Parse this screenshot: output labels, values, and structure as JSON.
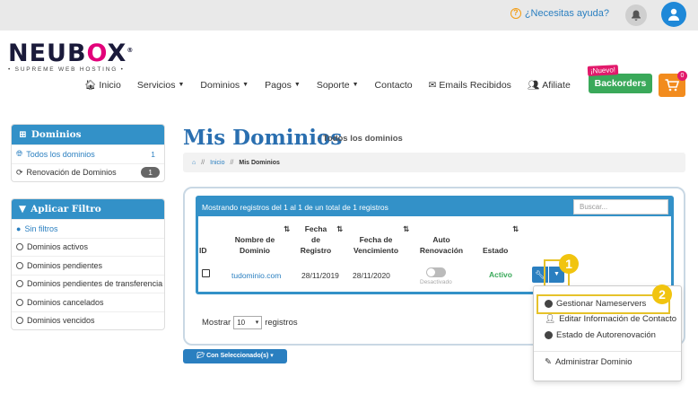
{
  "topbar": {
    "help_text": "¿Necesitas ayuda?"
  },
  "logo": {
    "name_a": "NEUB",
    "name_x": "O",
    "name_b": "X",
    "registered": "®",
    "tagline": "• SUPREME WEB HOSTING •"
  },
  "nav": {
    "items": [
      {
        "label": "Inicio"
      },
      {
        "label": "Servicios"
      },
      {
        "label": "Dominios"
      },
      {
        "label": "Pagos"
      },
      {
        "label": "Soporte"
      },
      {
        "label": "Contacto"
      },
      {
        "label": "Emails Recibidos"
      },
      {
        "label": "Afiliate"
      }
    ],
    "nuevo_tag": "¡Nuevo!",
    "backorders": "Backorders",
    "cart_count": "0"
  },
  "sidebar": {
    "dominios_title": "Dominios",
    "dominios_items": [
      {
        "label": "Todos los dominios",
        "count": "1"
      },
      {
        "label": "Renovación de Dominios",
        "count": "1"
      }
    ],
    "filtro_title": "Aplicar Filtro",
    "filtro_items": [
      {
        "label": "Sin filtros"
      },
      {
        "label": "Dominios activos"
      },
      {
        "label": "Dominios pendientes"
      },
      {
        "label": "Dominios pendientes de transferencia"
      },
      {
        "label": "Dominios cancelados"
      },
      {
        "label": "Dominios vencidos"
      }
    ]
  },
  "main": {
    "title": "Mis Dominios",
    "subtitle": "- Todos los dominios",
    "breadcrumb": {
      "sep": "//",
      "inicio": "Inicio",
      "current": "Mis Dominios"
    },
    "table": {
      "info": "Mostrando registros del 1 al 1 de un total de 1 registros",
      "search_placeholder": "Buscar...",
      "headers": {
        "id": "ID",
        "nombre_1": "Nombre de",
        "nombre_2": "Dominio",
        "fecha_reg_1": "Fecha",
        "fecha_reg_2": "de",
        "fecha_reg_3": "Registro",
        "fecha_venc_1": "Fecha de",
        "fecha_venc_2": "Vencimiento",
        "auto_1": "Auto",
        "auto_2": "Renovación",
        "estado": "Estado"
      },
      "row": {
        "domain": "tudominio.com",
        "registered": "28/11/2019",
        "expires": "28/11/2020",
        "auto_label": "Desactivado",
        "status": "Activo"
      }
    },
    "show": {
      "prefix": "Mostrar",
      "value": "10",
      "suffix": "registros"
    },
    "with_selected": "Con Seleccionado(s)"
  },
  "dropdown": {
    "items": [
      "Gestionar Nameservers",
      "Editar Información de Contacto",
      "Estado de Autorenovación",
      "Administrar Dominio"
    ]
  },
  "callouts": {
    "one": "1",
    "two": "2"
  },
  "colors": {
    "primary": "#3391c8",
    "success": "#3aa95a",
    "highlight": "#e6c22a",
    "brand_pink": "#e2007a",
    "cart": "#f28c1e"
  }
}
